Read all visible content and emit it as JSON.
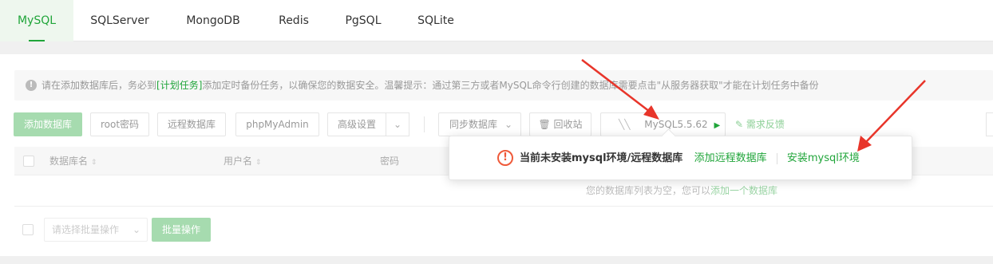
{
  "tabs": [
    {
      "label": "MySQL",
      "active": true
    },
    {
      "label": "SQLServer"
    },
    {
      "label": "MongoDB"
    },
    {
      "label": "Redis"
    },
    {
      "label": "PgSQL"
    },
    {
      "label": "SQLite"
    }
  ],
  "tip": {
    "icon": "info-icon",
    "text_before": "请在添加数据库后，务必到",
    "link": "[计划任务]",
    "text_after": "添加定时备份任务，以确保您的数据安全。温馨提示：通过第三方或者MySQL命令行创建的数据库需要点击\"从服务器获取\"才能在计划任务中备份"
  },
  "toolbar": {
    "add_db": "添加数据库",
    "root_pw": "root密码",
    "remote_db": "远程数据库",
    "phpmyadmin": "phpMyAdmin",
    "advanced": "高级设置",
    "sync_db": "同步数据库",
    "recycle": "回收站",
    "version": "MySQL5.5.62",
    "feedback": "需求反馈"
  },
  "table": {
    "headers": [
      "数据库名",
      "用户名",
      "密码"
    ],
    "empty_text": "您的数据库列表为空，您可以",
    "empty_link": "添加一个数据库"
  },
  "batch": {
    "select_placeholder": "请选择批量操作",
    "button": "批量操作"
  },
  "popup": {
    "message": "当前未安装mysql环境/远程数据库",
    "link_add_remote": "添加远程数据库",
    "link_install": "安装mysql环境"
  },
  "colors": {
    "accent": "#20a53a",
    "arrow": "#e8352a",
    "warning": "#ef5a3a"
  }
}
